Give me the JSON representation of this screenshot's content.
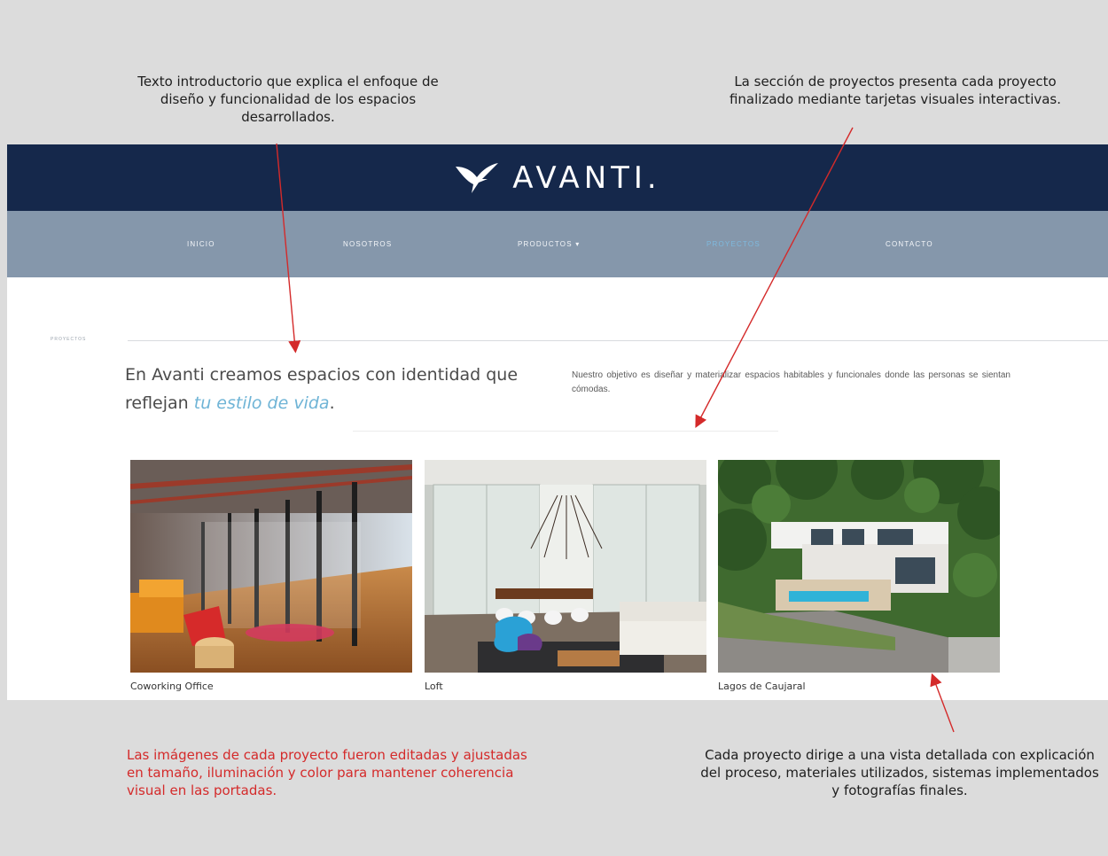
{
  "annotations": {
    "top_left": "Texto introductorio que explica el enfoque de diseño y funcionalidad de los espacios desarrollados.",
    "top_right": "La sección de proyectos presenta cada proyecto finalizado mediante tarjetas visuales interactivas.",
    "bottom_left": "Las imágenes de cada proyecto fueron editadas y ajustadas en tamaño, iluminación y color para mantener coherencia visual en las portadas.",
    "bottom_right": "Cada proyecto dirige a una vista detallada con explicación del proceso, materiales utilizados, sistemas implementados y fotografías finales."
  },
  "header": {
    "logo_text": "AVANTI."
  },
  "nav": {
    "items": [
      {
        "label": "INICIO"
      },
      {
        "label": "NOSOTROS"
      },
      {
        "label": "PRODUCTOS ▾"
      },
      {
        "label": "PROYECTOS"
      },
      {
        "label": "CONTACTO"
      }
    ]
  },
  "section": {
    "breadcrumb": "PROYECTOS",
    "headline_plain": "En Avanti creamos espacios con identidad que reflejan ",
    "headline_accent": "tu estilo de vida",
    "headline_end": ".",
    "intro": "Nuestro objetivo es diseñar y materializar espacios habitables y funcionales donde las personas se sientan cómodas."
  },
  "projects": [
    {
      "title": "Coworking Office"
    },
    {
      "title": "Loft"
    },
    {
      "title": "Lagos de Caujaral"
    }
  ],
  "colors": {
    "header_bg": "#15284b",
    "nav_bg": "#8597ab",
    "accent": "#6fb4d6",
    "annotation_red": "#d42a2a"
  }
}
